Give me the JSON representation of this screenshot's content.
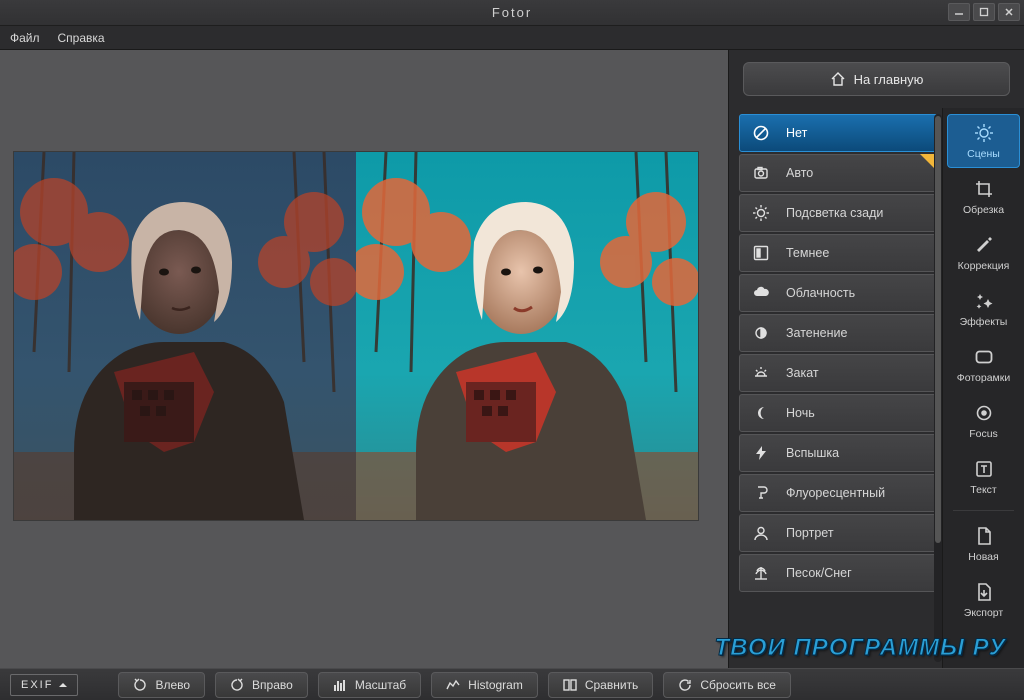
{
  "window": {
    "title": "Fotor"
  },
  "menu": {
    "file": "Файл",
    "help": "Справка"
  },
  "home_button": "На главную",
  "scenes": [
    {
      "key": "none",
      "label": "Нет",
      "active": true
    },
    {
      "key": "auto",
      "label": "Авто",
      "starred": true
    },
    {
      "key": "backlit",
      "label": "Подсветка сзади"
    },
    {
      "key": "darker",
      "label": "Темнее"
    },
    {
      "key": "cloudy",
      "label": "Облачность"
    },
    {
      "key": "shade",
      "label": "Затенение"
    },
    {
      "key": "sunset",
      "label": "Закат"
    },
    {
      "key": "night",
      "label": "Ночь"
    },
    {
      "key": "flash",
      "label": "Вспышка"
    },
    {
      "key": "fluorescent",
      "label": "Флуоресцентный"
    },
    {
      "key": "portrait",
      "label": "Портрет"
    },
    {
      "key": "sand_snow",
      "label": "Песок/Снег"
    }
  ],
  "tools": [
    {
      "key": "scenes",
      "label": "Сцены",
      "active": true
    },
    {
      "key": "crop",
      "label": "Обрезка"
    },
    {
      "key": "adjust",
      "label": "Коррекция"
    },
    {
      "key": "effects",
      "label": "Эффекты"
    },
    {
      "key": "frames",
      "label": "Фоторамки"
    },
    {
      "key": "focus",
      "label": "Focus"
    },
    {
      "key": "text",
      "label": "Текст"
    },
    {
      "key": "new",
      "label": "Новая",
      "sep_before": true
    },
    {
      "key": "export",
      "label": "Экспорт"
    }
  ],
  "bottom": {
    "exif": "EXIF",
    "rotate_left": "Влево",
    "rotate_right": "Вправо",
    "zoom": "Масштаб",
    "histogram": "Histogram",
    "compare": "Сравнить",
    "reset": "Сбросить все"
  },
  "watermark": "ТВОИ ПРОГРАММЫ РУ"
}
